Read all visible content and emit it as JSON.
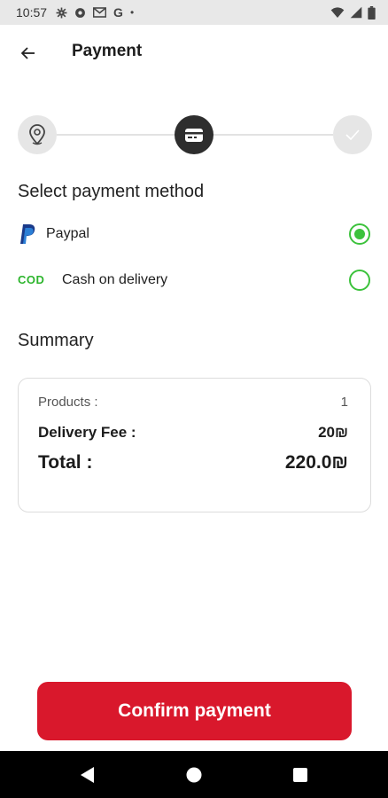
{
  "status_bar": {
    "time": "10:57",
    "icons": [
      "gear-icon",
      "shield-icon",
      "mail-icon",
      "google-icon",
      "dot-icon",
      "wifi-icon",
      "signal-icon",
      "battery-icon"
    ],
    "google_letter": "G",
    "dot": "•"
  },
  "header": {
    "title": "Payment",
    "back_icon": "back-arrow-icon"
  },
  "stepper": {
    "steps": [
      {
        "icon": "location-pin-icon",
        "state": "done"
      },
      {
        "icon": "card-icon",
        "state": "active"
      },
      {
        "icon": "check-icon",
        "state": "pending"
      }
    ]
  },
  "payment": {
    "title": "Select payment method",
    "methods": [
      {
        "label": "Paypal",
        "icon": "paypal-icon",
        "selected": true
      },
      {
        "label": "Cash on delivery",
        "icon_text": "COD",
        "selected": false
      }
    ]
  },
  "summary": {
    "title": "Summary",
    "products_label": "Products :",
    "products_value": "1",
    "fee_label": "Delivery Fee :",
    "fee_value": "20₪",
    "total_label": "Total :",
    "total_value": "220.0₪"
  },
  "actions": {
    "confirm_label": "Confirm payment"
  },
  "colors": {
    "accent_red": "#d9182c",
    "radio_green": "#3cc23c",
    "step_active": "#2e2e2e",
    "step_inactive": "#e6e6e6"
  },
  "nav": {
    "icons": [
      "nav-back-icon",
      "nav-home-icon",
      "nav-recents-icon"
    ]
  }
}
